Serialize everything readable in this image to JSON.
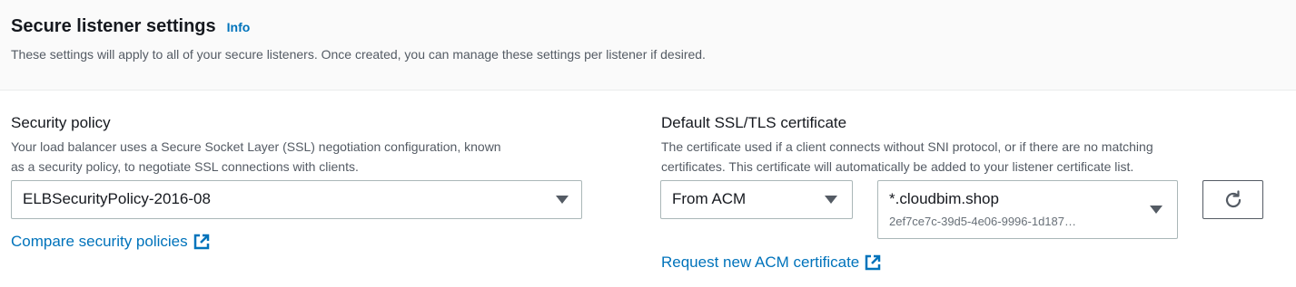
{
  "header": {
    "title": "Secure listener settings",
    "info_label": "Info",
    "description": "These settings will apply to all of your secure listeners. Once created, you can manage these settings per listener if desired."
  },
  "security_policy": {
    "label": "Security policy",
    "description_line1": "Your load balancer uses a Secure Socket Layer (SSL) negotiation configuration, known",
    "description_line2": "as a security policy, to negotiate SSL connections with clients.",
    "selected_value": "ELBSecurityPolicy-2016-08",
    "compare_link": "Compare security policies"
  },
  "certificate": {
    "label": "Default SSL/TLS certificate",
    "description_line1": "The certificate used if a client connects without SNI protocol, or if there are no matching",
    "description_line2": "certificates. This certificate will automatically be added to your listener certificate list.",
    "source_value": "From ACM",
    "cert_name": "*.cloudbim.shop",
    "cert_id": "2ef7ce7c-39d5-4e06-9996-1d187…",
    "request_link": "Request new ACM certificate"
  },
  "icons": {
    "external": "external-link-icon",
    "refresh": "refresh-icon",
    "caret": "caret-down-icon"
  },
  "colors": {
    "link": "#0073bb",
    "text": "#16191f",
    "secondary_text": "#545b64",
    "header_bg": "#fafafa"
  }
}
